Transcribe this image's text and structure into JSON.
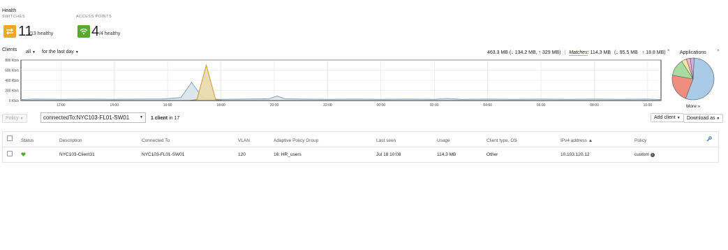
{
  "health": {
    "title": "Health",
    "switches": {
      "label": "SWITCHES",
      "count": "11",
      "total": "/13 healthy",
      "color": "#f0a824"
    },
    "access_points": {
      "label": "ACCESS POINTS",
      "count": "4",
      "total": "/4 healthy",
      "color": "#5aa832"
    }
  },
  "clients": {
    "label": "Clients",
    "filter_all": "all",
    "time_range": "for the last day",
    "usage_total": "463.3 MB (",
    "usage_down": "↓ 134.2 MB, ",
    "usage_up": "↑ 329 MB)",
    "matches_label": "Matches",
    "matches_value": ": 114.3 MB",
    "matches_down": "(↓ 95.5 MB",
    "matches_up": "↑ 18.8 MB)"
  },
  "chart_data": {
    "type": "area",
    "ylabel_ticks": [
      "800 Kb/s",
      "600 Kb/s",
      "400 Kb/s",
      "200 Kb/s",
      "0 Kb/s"
    ],
    "ylim": [
      0,
      800
    ],
    "x_ticks": [
      "12:00",
      "14:00",
      "16:00",
      "18:00",
      "20:00",
      "22:00",
      "00:00",
      "02:00",
      "04:00",
      "06:00",
      "08:00",
      "10:00"
    ],
    "series": [
      {
        "color": "#7a9bb3",
        "fill": "#d6e2ea",
        "x": [
          10.5,
          11,
          12,
          13,
          14,
          15,
          15.8,
          16.5,
          16.9,
          17.3,
          17.6,
          18,
          19,
          19.8,
          20.1,
          20.4,
          21,
          22,
          23,
          24,
          25,
          26,
          26.5,
          27,
          28,
          29,
          30,
          31,
          32,
          33,
          34,
          34.5
        ],
        "y": [
          20,
          30,
          25,
          30,
          25,
          30,
          30,
          60,
          360,
          60,
          30,
          25,
          30,
          35,
          90,
          35,
          30,
          25,
          30,
          25,
          30,
          25,
          40,
          25,
          30,
          25,
          30,
          25,
          30,
          25,
          30,
          20
        ]
      },
      {
        "color": "#c7922c",
        "fill": "#e8d9a8",
        "x": [
          10.5,
          16.8,
          17.1,
          17.45,
          17.8,
          18.1,
          34.5
        ],
        "y": [
          0,
          0,
          20,
          700,
          20,
          0,
          0
        ]
      }
    ]
  },
  "applications": {
    "label": "Applications",
    "more": "More »"
  },
  "applications_pie": [
    {
      "value": 55,
      "color": "#a9cbe6"
    },
    {
      "value": 22,
      "color": "#f08c80"
    },
    {
      "value": 13,
      "color": "#a6dca0"
    },
    {
      "value": 4,
      "color": "#f5e6a0"
    },
    {
      "value": 3,
      "color": "#f5b0d0"
    },
    {
      "value": 3,
      "color": "#c9b3e0"
    }
  ],
  "toolbar": {
    "policy": "Policy",
    "search_value": "connectedTo:NYC103-FL01-SW01",
    "client_count_bold": "1 client",
    "client_count_rest": " in 17",
    "add_client": "Add client",
    "download_as": "Download as"
  },
  "table": {
    "headers": [
      "Status",
      "Description",
      "Connected To",
      "VLAN",
      "Adaptive Policy Group",
      "Last seen",
      "Usage",
      "Client type, OS",
      "IPv4 address ▲",
      "Policy"
    ],
    "rows": [
      {
        "description": "NYC103-Client31",
        "connected_to": "NYC103-FL01-SW01",
        "vlan": "120",
        "apg": "16: HR_users",
        "last_seen": "Jul 18 10:08",
        "usage": "114.3 MB",
        "client_type": "Other",
        "ipv4": "10.103.120.12",
        "policy": "custom"
      }
    ]
  },
  "colors": {
    "link": "#1f66b4",
    "healthy_green": "#5aa832"
  }
}
